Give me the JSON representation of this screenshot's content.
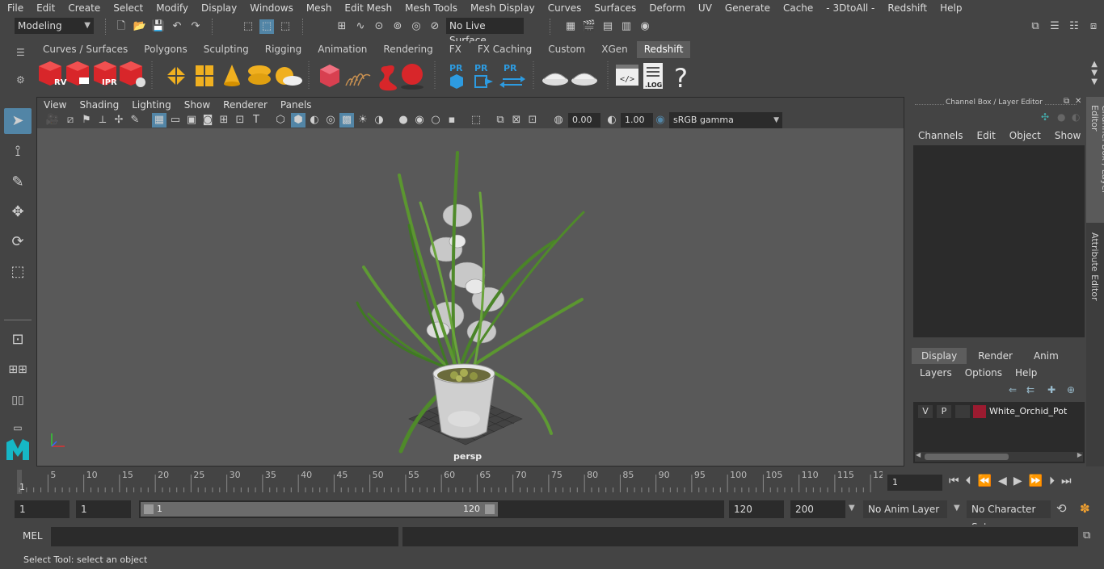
{
  "menubar": [
    "File",
    "Edit",
    "Create",
    "Select",
    "Modify",
    "Display",
    "Windows",
    "Mesh",
    "Edit Mesh",
    "Mesh Tools",
    "Mesh Display",
    "Curves",
    "Surfaces",
    "Deform",
    "UV",
    "Generate",
    "Cache",
    "- 3DtoAll -",
    "Redshift",
    "Help"
  ],
  "status": {
    "mode": "Modeling",
    "live_surface": "No Live Surface"
  },
  "shelf_tabs": [
    "Curves / Surfaces",
    "Polygons",
    "Sculpting",
    "Rigging",
    "Animation",
    "Rendering",
    "FX",
    "FX Caching",
    "Custom",
    "XGen",
    "Redshift"
  ],
  "shelf_active": "Redshift",
  "shelf_icons": {
    "rv": "RV",
    "ipr": "IPR",
    "pr1": "PR",
    "pr2": "PR",
    "pr3": "PR",
    "log": ".LOG",
    "help": "?"
  },
  "viewport": {
    "menus": [
      "View",
      "Shading",
      "Lighting",
      "Show",
      "Renderer",
      "Panels"
    ],
    "exposure": "0.00",
    "gamma": "1.00",
    "colorspace": "sRGB gamma",
    "camera_label": "persp"
  },
  "channel_box": {
    "title": "Channel Box / Layer Editor",
    "menus": [
      "Channels",
      "Edit",
      "Object",
      "Show"
    ],
    "layer_tabs": [
      "Display",
      "Render",
      "Anim"
    ],
    "layer_menus": [
      "Layers",
      "Options",
      "Help"
    ],
    "layer": {
      "v": "V",
      "p": "P",
      "name": "White_Orchid_Pot",
      "color": "#9b1b30"
    }
  },
  "side_tabs": [
    "Channel Box / Layer Editor",
    "Attribute Editor"
  ],
  "timeline": {
    "ticks": [
      "5",
      "10",
      "15",
      "20",
      "25",
      "30",
      "35",
      "40",
      "45",
      "50",
      "55",
      "60",
      "65",
      "70",
      "75",
      "80",
      "85",
      "90",
      "95",
      "100",
      "105",
      "110",
      "115",
      "12"
    ],
    "start_marker": "1",
    "current_frame": "1"
  },
  "range": {
    "start": "1",
    "playback_start": "1",
    "slider_start": "1",
    "slider_end": "120",
    "playback_end": "120",
    "end": "200",
    "anim_layer": "No Anim Layer",
    "char_set": "No Character Set"
  },
  "cmd": {
    "label": "MEL"
  },
  "help_text": "Select Tool: select an object",
  "colors": {
    "accent": "#5285a6",
    "shelf_red": "#d8262a",
    "shelf_yellow": "#f0b020",
    "pr_blue": "#2d9be0"
  }
}
